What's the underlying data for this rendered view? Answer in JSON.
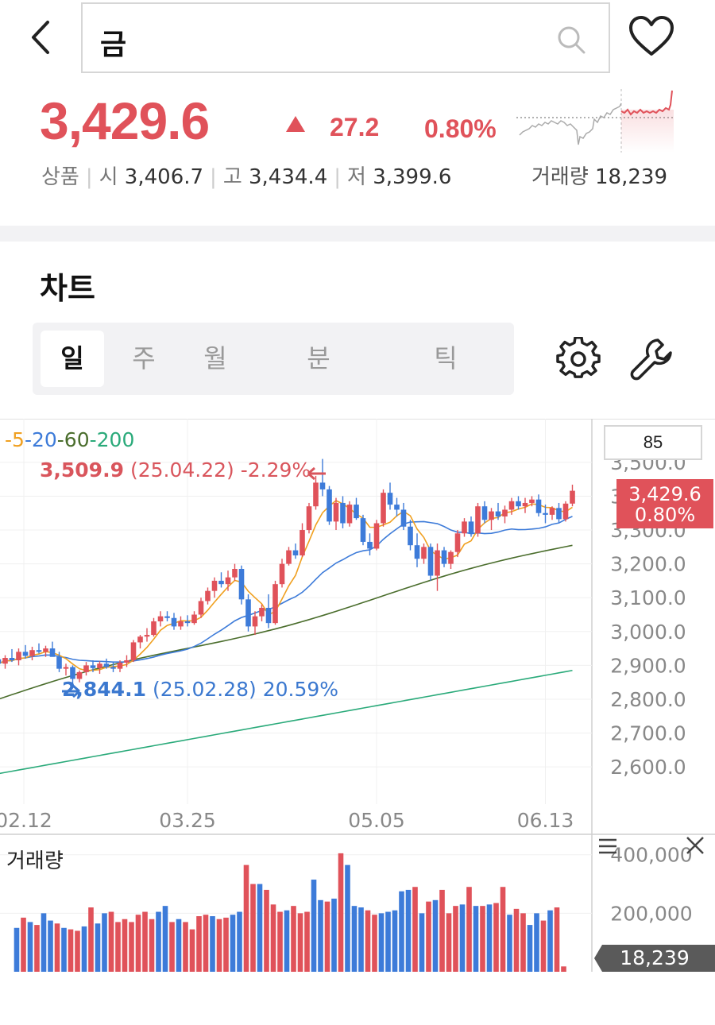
{
  "search": {
    "query": "금"
  },
  "quote": {
    "price": "3,429.6",
    "change": "27.2",
    "change_pct": "0.80%",
    "category": "상품",
    "open_label": "시",
    "open": "3,406.7",
    "high_label": "고",
    "high": "3,434.4",
    "low_label": "저",
    "low": "3,399.6",
    "volume_label": "거래량",
    "volume": "18,239"
  },
  "chart_section": {
    "title": "차트",
    "tabs": [
      "일",
      "주",
      "월",
      "분",
      "틱"
    ],
    "active_tab": "일"
  },
  "colors": {
    "up": "#e0525a",
    "down": "#3d7bd9",
    "ma5": "#f0a020",
    "ma20": "#3d7bd9",
    "ma60": "#4a6d2c",
    "ma200": "#2aaa7a"
  },
  "chart_data": {
    "type": "candlestick",
    "ma_legend": [
      "-5",
      "-20",
      "-60",
      "-200"
    ],
    "setting_value": "85",
    "high_marker": {
      "value": "3,509.9",
      "date": "(25.04.22)",
      "pct": "-2.29%"
    },
    "low_marker": {
      "value": "2,844.1",
      "date": "(25.02.28)",
      "pct": "20.59%"
    },
    "price_tag": {
      "price": "3,429.6",
      "pct": "0.80%"
    },
    "y_ticks": [
      "3,500.0",
      "3,400.0",
      "3,300.0",
      "3,200.0",
      "3,100.0",
      "3,000.0",
      "2,900.0",
      "2,800.0",
      "2,700.0",
      "2,600.0"
    ],
    "ylim": [
      2490,
      3610
    ],
    "x_ticks": [
      "02.12",
      "03.25",
      "05.05",
      "06.13"
    ],
    "ohlc": [
      [
        2918,
        2935,
        2895,
        2905
      ],
      [
        2905,
        2930,
        2890,
        2922
      ],
      [
        2922,
        2948,
        2910,
        2915
      ],
      [
        2915,
        2950,
        2900,
        2940
      ],
      [
        2940,
        2960,
        2920,
        2928
      ],
      [
        2928,
        2955,
        2915,
        2945
      ],
      [
        2945,
        2965,
        2935,
        2940
      ],
      [
        2940,
        2958,
        2925,
        2950
      ],
      [
        2950,
        2970,
        2935,
        2925
      ],
      [
        2925,
        2940,
        2880,
        2890
      ],
      [
        2890,
        2905,
        2870,
        2895
      ],
      [
        2895,
        2900,
        2844,
        2860
      ],
      [
        2860,
        2885,
        2850,
        2880
      ],
      [
        2880,
        2910,
        2870,
        2900
      ],
      [
        2900,
        2915,
        2880,
        2892
      ],
      [
        2892,
        2912,
        2875,
        2905
      ],
      [
        2905,
        2920,
        2890,
        2895
      ],
      [
        2895,
        2910,
        2880,
        2890
      ],
      [
        2890,
        2915,
        2880,
        2908
      ],
      [
        2908,
        2930,
        2895,
        2915
      ],
      [
        2915,
        2975,
        2910,
        2968
      ],
      [
        2968,
        2990,
        2950,
        2985
      ],
      [
        2985,
        3010,
        2970,
        2990
      ],
      [
        2990,
        3040,
        2985,
        3030
      ],
      [
        3030,
        3060,
        3015,
        3045
      ],
      [
        3045,
        3060,
        3030,
        3040
      ],
      [
        3040,
        3055,
        3005,
        3015
      ],
      [
        3015,
        3045,
        3005,
        3030
      ],
      [
        3030,
        3048,
        3015,
        3025
      ],
      [
        3025,
        3060,
        3020,
        3050
      ],
      [
        3050,
        3100,
        3040,
        3090
      ],
      [
        3090,
        3130,
        3080,
        3120
      ],
      [
        3120,
        3160,
        3100,
        3150
      ],
      [
        3150,
        3175,
        3130,
        3140
      ],
      [
        3140,
        3180,
        3120,
        3160
      ],
      [
        3160,
        3200,
        3150,
        3185
      ],
      [
        3185,
        3195,
        3080,
        3095
      ],
      [
        3095,
        3110,
        3000,
        3015
      ],
      [
        3015,
        3060,
        2990,
        3045
      ],
      [
        3045,
        3080,
        3030,
        3070
      ],
      [
        3070,
        3110,
        3010,
        3025
      ],
      [
        3025,
        3150,
        3020,
        3140
      ],
      [
        3140,
        3215,
        3130,
        3200
      ],
      [
        3200,
        3250,
        3195,
        3240
      ],
      [
        3240,
        3260,
        3215,
        3225
      ],
      [
        3225,
        3320,
        3220,
        3300
      ],
      [
        3300,
        3380,
        3290,
        3370
      ],
      [
        3370,
        3460,
        3360,
        3440
      ],
      [
        3440,
        3510,
        3400,
        3420
      ],
      [
        3420,
        3430,
        3315,
        3325
      ],
      [
        3325,
        3395,
        3300,
        3380
      ],
      [
        3380,
        3400,
        3305,
        3320
      ],
      [
        3320,
        3385,
        3310,
        3375
      ],
      [
        3375,
        3395,
        3330,
        3335
      ],
      [
        3335,
        3345,
        3255,
        3265
      ],
      [
        3265,
        3290,
        3225,
        3245
      ],
      [
        3245,
        3330,
        3240,
        3320
      ],
      [
        3320,
        3420,
        3310,
        3410
      ],
      [
        3410,
        3440,
        3360,
        3375
      ],
      [
        3375,
        3395,
        3340,
        3360
      ],
      [
        3360,
        3380,
        3300,
        3310
      ],
      [
        3310,
        3330,
        3240,
        3255
      ],
      [
        3255,
        3290,
        3190,
        3215
      ],
      [
        3215,
        3260,
        3200,
        3250
      ],
      [
        3250,
        3260,
        3150,
        3165
      ],
      [
        3165,
        3260,
        3120,
        3240
      ],
      [
        3240,
        3250,
        3190,
        3200
      ],
      [
        3200,
        3240,
        3185,
        3235
      ],
      [
        3235,
        3300,
        3220,
        3290
      ],
      [
        3290,
        3335,
        3280,
        3325
      ],
      [
        3325,
        3340,
        3280,
        3290
      ],
      [
        3290,
        3380,
        3280,
        3370
      ],
      [
        3370,
        3385,
        3320,
        3330
      ],
      [
        3330,
        3365,
        3300,
        3355
      ],
      [
        3355,
        3380,
        3330,
        3340
      ],
      [
        3340,
        3372,
        3320,
        3360
      ],
      [
        3360,
        3395,
        3345,
        3385
      ],
      [
        3385,
        3400,
        3360,
        3370
      ],
      [
        3370,
        3395,
        3350,
        3380
      ],
      [
        3380,
        3400,
        3370,
        3390
      ],
      [
        3390,
        3405,
        3340,
        3350
      ],
      [
        3350,
        3375,
        3320,
        3345
      ],
      [
        3345,
        3370,
        3330,
        3365
      ],
      [
        3365,
        3380,
        3320,
        3332
      ],
      [
        3332,
        3385,
        3325,
        3378
      ],
      [
        3378,
        3434,
        3370,
        3416
      ]
    ],
    "volume_ticks": [
      "400,000",
      "200,000"
    ],
    "volume_tag": "18,239",
    "volume_title": "거래량",
    "volumes": [
      150000,
      185000,
      170000,
      160000,
      200000,
      175000,
      165000,
      150000,
      145000,
      140000,
      155000,
      220000,
      165000,
      200000,
      205000,
      170000,
      180000,
      170000,
      195000,
      205000,
      180000,
      205000,
      225000,
      170000,
      180000,
      170000,
      145000,
      190000,
      195000,
      190000,
      180000,
      185000,
      195000,
      205000,
      365000,
      300000,
      300000,
      280000,
      230000,
      205000,
      210000,
      225000,
      200000,
      205000,
      315000,
      245000,
      240000,
      250000,
      405000,
      365000,
      225000,
      220000,
      210000,
      195000,
      200000,
      205000,
      210000,
      275000,
      280000,
      290000,
      200000,
      240000,
      245000,
      280000,
      200000,
      225000,
      230000,
      290000,
      225000,
      225000,
      230000,
      235000,
      290000,
      195000,
      215000,
      200000,
      160000,
      200000,
      175000,
      210000,
      220000,
      18239
    ],
    "volume_ylim": [
      0,
      440000
    ]
  }
}
